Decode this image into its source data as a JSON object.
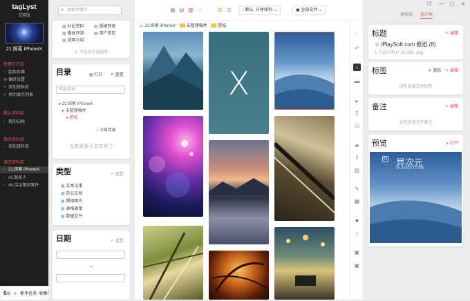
{
  "sidebar": {
    "app_name": "tagLyst",
    "app_edition": "试用版",
    "library_name": "21.探索 iPhoneX",
    "sections": [
      {
        "title": "快捷方式组",
        "items": [
          {
            "icon": "doc-icon",
            "label": "起始页面"
          },
          {
            "icon": "gear-icon",
            "label": "偏好设置"
          },
          {
            "icon": "plus-icon",
            "label": "添加资料库"
          },
          {
            "icon": "close-icon",
            "label": "关闭演示列表"
          }
        ]
      },
      {
        "title": "默认资料库",
        "items": [
          {
            "icon": "doc-icon",
            "label": "我的归档"
          }
        ]
      },
      {
        "title": "我的资料库",
        "items": [
          {
            "icon": "doc-icon",
            "label": "添加资料库"
          }
        ]
      },
      {
        "title": "演示资料库",
        "items": [
          {
            "icon": "doc-icon",
            "label": "21.探索 iPhoneX",
            "active": true
          },
          {
            "icon": "doc-icon",
            "label": "42.联系人"
          },
          {
            "icon": "doc-icon",
            "label": "46.活动策划案件"
          }
        ]
      }
    ],
    "task": {
      "count": "0",
      "total": "/8",
      "text": "新手任务: 收集所有奖杯"
    }
  },
  "filter": {
    "search_placeholder": "搜索关键字",
    "quick_links": [
      "对比资料",
      "规格列表",
      "媒体评测",
      "用户意见",
      "说明介绍"
    ],
    "quick_note": "不会显示在标签",
    "dir": {
      "title": "目录",
      "open": "打开",
      "reset": "重置",
      "filter_placeholder": "筛选目录",
      "tree": [
        "21.探索 iPhoneX",
        "未整理稿件",
        "壁纸"
      ],
      "up": "上级目录",
      "empty": "没有更多子文件夹了"
    },
    "types": {
      "title": "类型",
      "reset": "重置",
      "items": [
        "文本记事",
        "办公文档",
        "照相图片",
        "表格表单",
        "数据文件"
      ]
    },
    "date": {
      "title": "日期",
      "reset": "重置"
    }
  },
  "main": {
    "sort": "默认: 升序排列",
    "scope": "全部文件",
    "breadcrumb": [
      "21.探索 iPhoneX",
      "未整理稿件",
      "壁纸"
    ],
    "x_letter": "X"
  },
  "panel": {
    "tabs": [
      "资料库",
      "选中项"
    ],
    "title": {
      "heading": "标题",
      "edit": "编辑",
      "file_name": "iPlaySoft.com 壁纸 (8)",
      "meta": "1 个选中项 (7.23 MB) .png"
    },
    "tags": {
      "heading": "标签",
      "clear": "清除",
      "edit": "编辑",
      "empty": "没有发现文件标签"
    },
    "notes": {
      "heading": "备注",
      "edit": "编辑",
      "empty": "没有发现文件备注"
    },
    "preview": {
      "heading": "预览",
      "open": "打开",
      "watermark": "异次元",
      "watermark_sub": "IPLAYSOFT.COM"
    }
  },
  "colors": {
    "accent": "#e25555",
    "sidebar_bg": "#1e1e1e",
    "folder": "#f2c34f"
  }
}
